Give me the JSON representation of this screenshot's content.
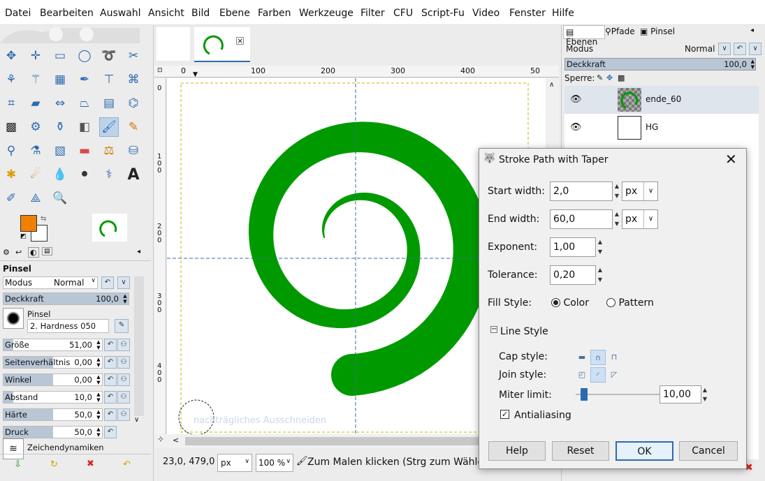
{
  "menu": [
    "Datei",
    "Bearbeiten",
    "Auswahl",
    "Ansicht",
    "Bild",
    "Ebene",
    "Farben",
    "Werkzeuge",
    "Filter",
    "CFU",
    "Script-Fu",
    "Video",
    "Fenster",
    "Hilfe"
  ],
  "image_tab": {
    "close_icon": "close-icon"
  },
  "ruler": {
    "top_ticks": [
      "0",
      "100",
      "200",
      "300",
      "400",
      "50"
    ],
    "left_ticks": [
      "0",
      "1\n0\n0",
      "2\n0\n0",
      "3\n0\n0",
      "4\n0\n0"
    ]
  },
  "canvas": {
    "stroke_color": "#009a00",
    "ghost_text": "nachträgliches Ausschneiden"
  },
  "statusbar": {
    "coords": "23,0, 479,0",
    "unit": "px",
    "zoom": "100 %",
    "message": "Zum Malen klicken (Strg zum Wählen"
  },
  "tool_options": {
    "title": "Pinsel",
    "mode_label": "Modus",
    "mode_value": "Normal",
    "opacity_label": "Deckkraft",
    "opacity_value": "100,0",
    "brush_label": "Pinsel",
    "brush_name": "2. Hardness 050",
    "rows": [
      {
        "label": "Größe",
        "value": "51,00",
        "fill": 0.1
      },
      {
        "label": "Seitenverhältnis",
        "value": "0,00",
        "fill": 0.5
      },
      {
        "label": "Winkel",
        "value": "0,00",
        "fill": 0.5
      },
      {
        "label": "Abstand",
        "value": "10,0",
        "fill": 0.1
      },
      {
        "label": "Härte",
        "value": "50,0",
        "fill": 0.5
      },
      {
        "label": "Druck",
        "value": "50,0",
        "fill": 0.5
      }
    ],
    "dynamics_label": "Zeichendynamiken"
  },
  "fg_color": "#f08000",
  "bg_color": "#ffffff",
  "layers_panel": {
    "tabs": [
      "Ebenen",
      "Pfade",
      "Pinsel"
    ],
    "mode_label": "Modus",
    "mode_value": "Normal",
    "opacity_label": "Deckkraft",
    "opacity_value": "100,0",
    "lock_label": "Sperre:",
    "layers": [
      {
        "name": "ende_60"
      },
      {
        "name": "HG"
      }
    ]
  },
  "dialog": {
    "title": "Stroke Path with Taper",
    "start_width_label": "Start width:",
    "start_width_value": "2,0",
    "start_unit": "px",
    "end_width_label": "End width:",
    "end_width_value": "60,0",
    "end_unit": "px",
    "exponent_label": "Exponent:",
    "exponent_value": "1,00",
    "tolerance_label": "Tolerance:",
    "tolerance_value": "0,20",
    "fill_style_label": "Fill Style:",
    "fill_color": "Color",
    "fill_pattern": "Pattern",
    "line_style_label": "Line Style",
    "cap_style_label": "Cap style:",
    "join_style_label": "Join style:",
    "miter_label": "Miter limit:",
    "miter_value": "10,00",
    "miter_level": 0.1,
    "antialias_label": "Antialiasing",
    "buttons": {
      "help": "Help",
      "reset": "Reset",
      "ok": "OK",
      "cancel": "Cancel"
    }
  }
}
